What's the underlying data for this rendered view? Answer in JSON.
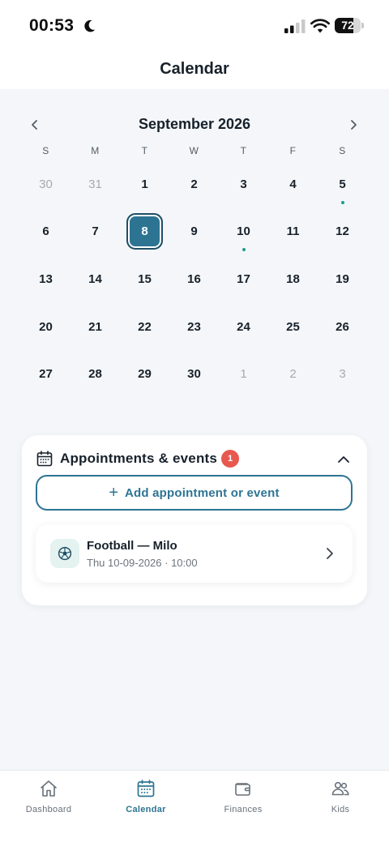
{
  "status_bar": {
    "time": "00:53",
    "battery": "72",
    "battery_fraction": 0.72
  },
  "header": {
    "title": "Calendar"
  },
  "calendar": {
    "month_label": "September 2026",
    "weekdays": [
      "S",
      "M",
      "T",
      "W",
      "T",
      "F",
      "S"
    ],
    "weeks": [
      [
        {
          "d": "30",
          "muted": true
        },
        {
          "d": "31",
          "muted": true
        },
        {
          "d": "1"
        },
        {
          "d": "2"
        },
        {
          "d": "3"
        },
        {
          "d": "4"
        },
        {
          "d": "5",
          "dot": true
        }
      ],
      [
        {
          "d": "6"
        },
        {
          "d": "7"
        },
        {
          "d": "8",
          "selected": true
        },
        {
          "d": "9"
        },
        {
          "d": "10",
          "dot": true
        },
        {
          "d": "11"
        },
        {
          "d": "12"
        }
      ],
      [
        {
          "d": "13"
        },
        {
          "d": "14"
        },
        {
          "d": "15"
        },
        {
          "d": "16"
        },
        {
          "d": "17"
        },
        {
          "d": "18"
        },
        {
          "d": "19"
        }
      ],
      [
        {
          "d": "20"
        },
        {
          "d": "21"
        },
        {
          "d": "22"
        },
        {
          "d": "23"
        },
        {
          "d": "24"
        },
        {
          "d": "25"
        },
        {
          "d": "26"
        }
      ],
      [
        {
          "d": "27"
        },
        {
          "d": "28"
        },
        {
          "d": "29"
        },
        {
          "d": "30"
        },
        {
          "d": "1",
          "muted": true
        },
        {
          "d": "2",
          "muted": true
        },
        {
          "d": "3",
          "muted": true
        }
      ]
    ]
  },
  "appointments": {
    "title": "Appointments & events",
    "badge_count": "1",
    "add_label": "Add appointment or event",
    "events": [
      {
        "title": "Football — Milo",
        "subtitle": "Thu 10-09-2026 · 10:00",
        "icon": "football-icon"
      }
    ]
  },
  "bottom_nav": [
    {
      "label": "Dashboard",
      "icon": "home-icon",
      "active": false
    },
    {
      "label": "Calendar",
      "icon": "calendar-icon",
      "active": true
    },
    {
      "label": "Finances",
      "icon": "wallet-icon",
      "active": false
    },
    {
      "label": "Kids",
      "icon": "people-icon",
      "active": false
    }
  ],
  "colors": {
    "accent": "#2d7493",
    "event_dot": "#1d9e8b",
    "badge": "#e8584e",
    "background": "#f4f6f9"
  }
}
